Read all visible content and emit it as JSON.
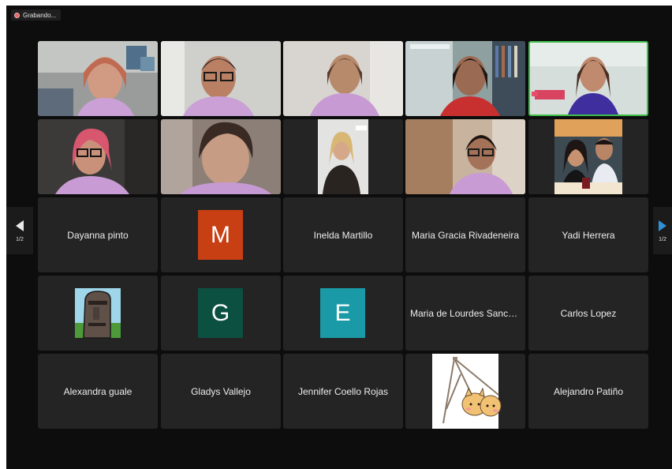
{
  "recording": {
    "label": "Grabando..."
  },
  "pager": {
    "prev_page": "1/2",
    "next_page": "1/2"
  },
  "colors": {
    "active_border": "#3fbf4a",
    "letter_m": "#c93f14",
    "letter_g": "#0c5042",
    "letter_e": "#1a9aa6",
    "next_arrow": "#2f8fd8"
  },
  "participants": {
    "dayanna": "Dayanna pinto",
    "inelda": "Inelda Martillo",
    "maria_gracia": "Maria Gracia Rivadeneira",
    "yadi": "Yadi Herrera",
    "maria_lourdes": "Maria de Lourdes Sanchez",
    "carlos": "Carlos Lopez",
    "alexandra": "Alexandra guale",
    "gladys": "Gladys Vallejo",
    "jennifer": "Jennifer Coello Rojas",
    "alejandro": "Alejandro Patiño"
  },
  "avatars": {
    "m": "M",
    "g": "G",
    "e": "E"
  },
  "icons": {
    "prev": "chevron-left-icon",
    "next": "chevron-right-icon",
    "moai": "moai-avatar-icon",
    "cat": "cat-sticker-icon"
  }
}
